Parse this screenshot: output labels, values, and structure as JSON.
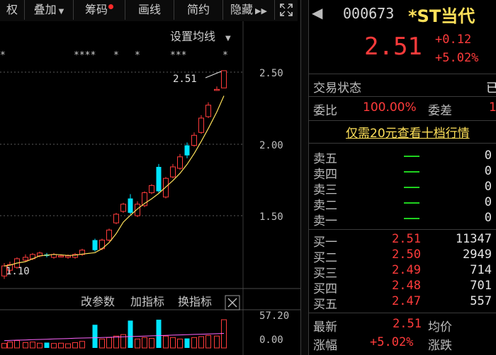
{
  "toolbar": {
    "items": [
      {
        "label": "权",
        "arrow": ""
      },
      {
        "label": "叠加",
        "arrow": "▼"
      },
      {
        "label": "筹码",
        "arrow": ""
      },
      {
        "label": "画线",
        "arrow": ""
      },
      {
        "label": "简约",
        "arrow": ""
      },
      {
        "label": "隐藏",
        "arrow": "▶▶"
      }
    ],
    "expand_icon": "fullscreen-icon"
  },
  "chart": {
    "settings_label": "设置均线",
    "price_ticks": [
      "2.50",
      "2.00",
      "1.50"
    ],
    "high_label": "2.51",
    "low_label": "1.10",
    "indicator_tabs": [
      "改参数",
      "加指标",
      "换指标"
    ],
    "volume_ticks": [
      "57.20",
      "0.00"
    ],
    "colors": {
      "up": "#ff3b3b",
      "down": "#00e5ff",
      "ma": "#ffe15a",
      "ma2": "#ff66ff"
    }
  },
  "quote": {
    "code": "000673",
    "name": "*ST当代",
    "price": "2.51",
    "change": "+0.12",
    "change_pct": "+5.02%",
    "status_label": "交易状态",
    "status_value": "已",
    "wb_label": "委比",
    "wb_value": "100.00%",
    "wc_label": "委差",
    "wc_value": "1",
    "promo_link": "仅需20元查看十档行情",
    "sell": [
      {
        "name": "卖五",
        "price": "—",
        "vol": "0"
      },
      {
        "name": "卖四",
        "price": "—",
        "vol": "0"
      },
      {
        "name": "卖三",
        "price": "—",
        "vol": "0"
      },
      {
        "name": "卖二",
        "price": "—",
        "vol": "0"
      },
      {
        "name": "卖一",
        "price": "—",
        "vol": "0"
      }
    ],
    "buy": [
      {
        "name": "买一",
        "price": "2.51",
        "vol": "11347"
      },
      {
        "name": "买二",
        "price": "2.50",
        "vol": "2949"
      },
      {
        "name": "买三",
        "price": "2.49",
        "vol": "714"
      },
      {
        "name": "买四",
        "price": "2.48",
        "vol": "701"
      },
      {
        "name": "买五",
        "price": "2.47",
        "vol": "557"
      }
    ],
    "latest_label": "最新",
    "latest_value": "2.51",
    "avg_label": "均价",
    "pct_label": "涨幅",
    "pct_value": "+5.02%",
    "updown_label": "涨跌"
  }
}
